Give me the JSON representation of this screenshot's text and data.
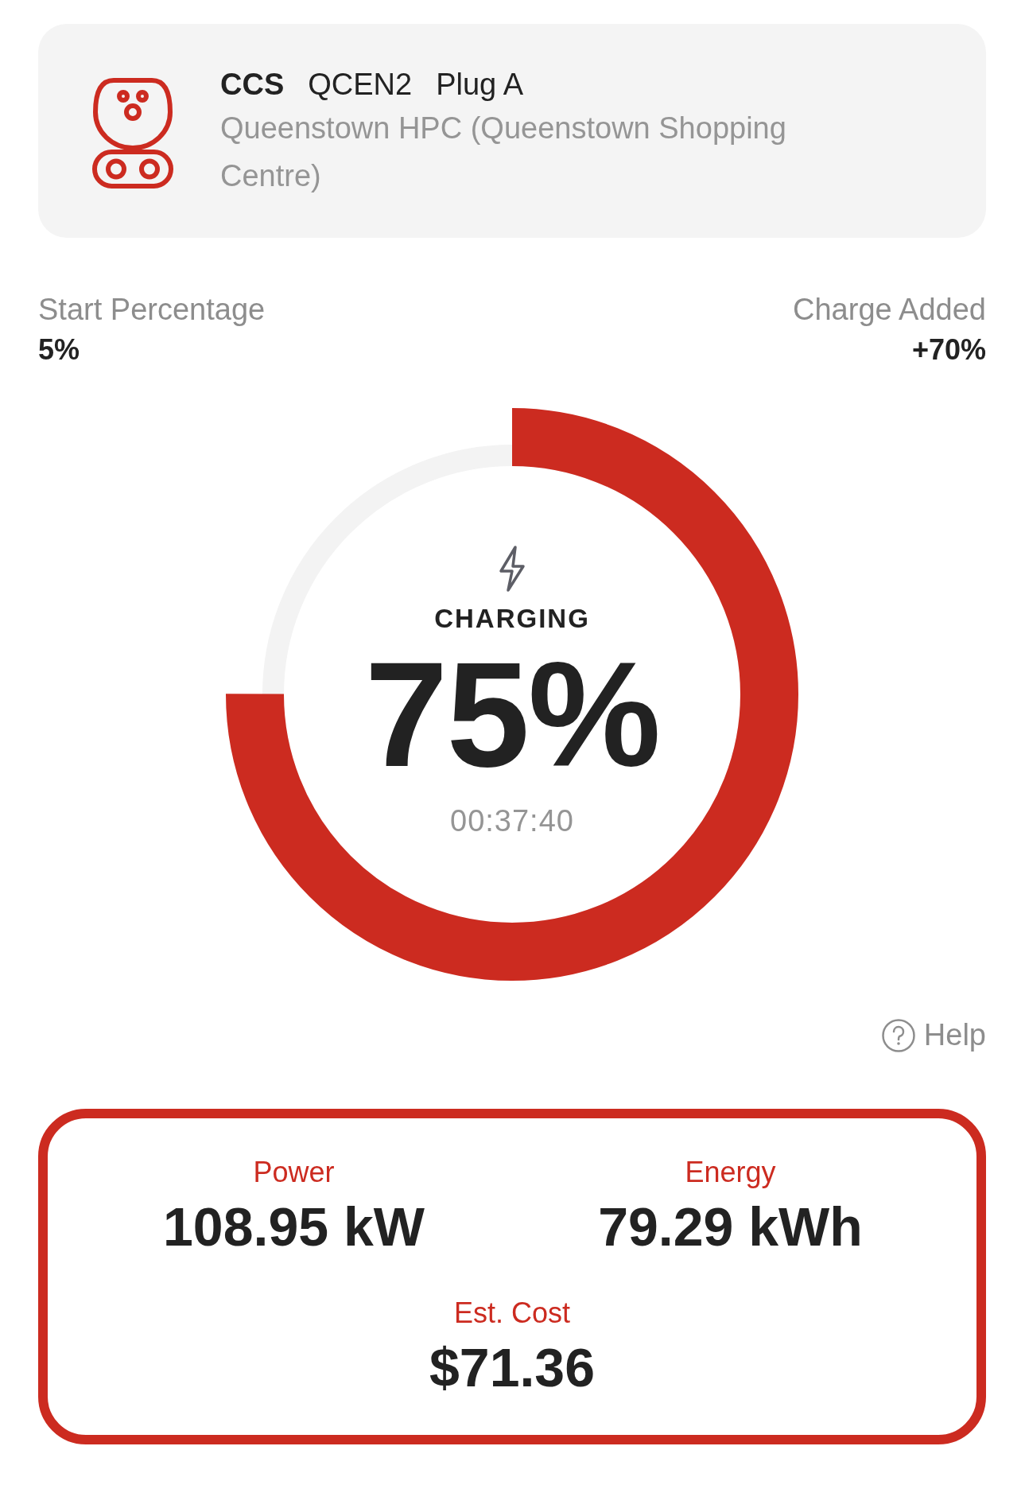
{
  "connector": {
    "type": "CCS",
    "code": "QCEN2",
    "plug": "Plug A",
    "location": "Queenstown HPC (Queenstown Shopping Centre)"
  },
  "stats": [
    {
      "label": "Start Percentage",
      "value": "5%"
    },
    {
      "label": "Charge Added",
      "value": "+70%"
    }
  ],
  "gauge": {
    "status": "CHARGING",
    "level": 0.75,
    "percent": "75%",
    "elapsed": "00:37:40"
  },
  "help": {
    "label": "Help"
  },
  "metrics": [
    {
      "label": "Power",
      "value": "108.95 kW"
    },
    {
      "label": "Energy",
      "value": "79.29 kWh"
    },
    {
      "label": "Est. Cost",
      "value": "$71.36"
    }
  ]
}
